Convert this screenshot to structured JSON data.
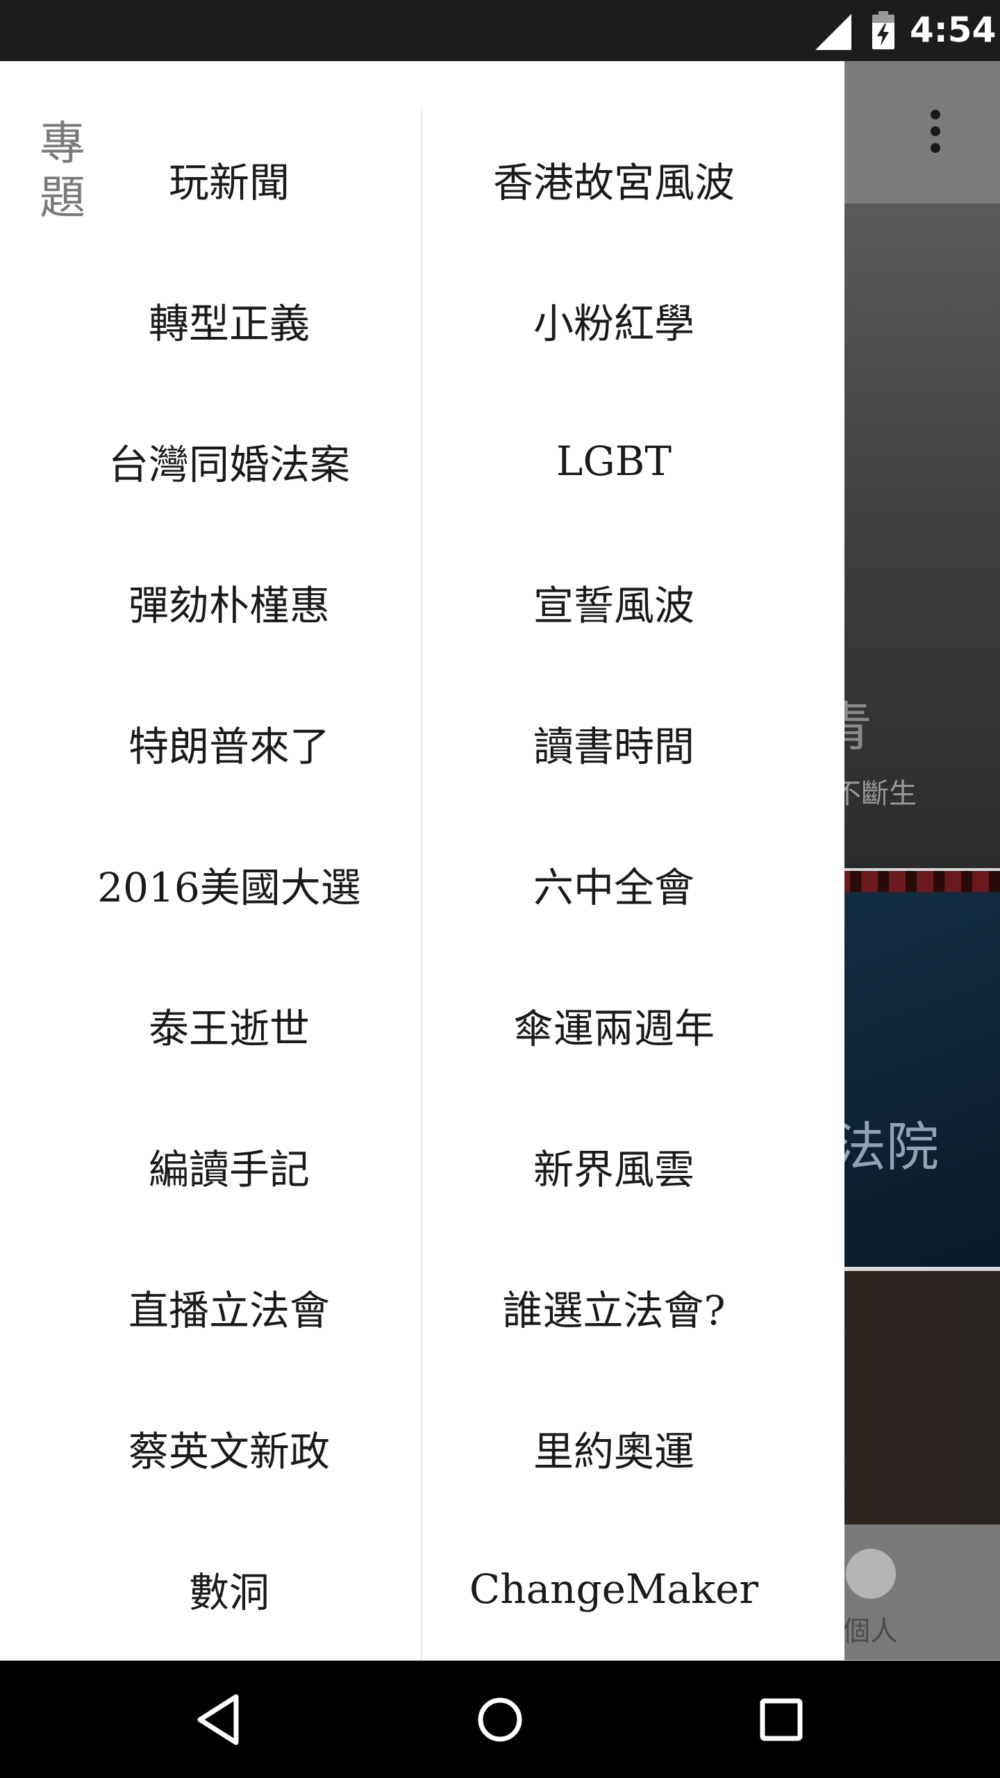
{
  "status_bar": {
    "time": "4:54",
    "icons": [
      "signal-icon",
      "battery-charging-icon"
    ]
  },
  "background": {
    "card1_title": "青",
    "card1_subtitle": "不斷生",
    "card2_title": "法院",
    "bottom_nav_label": "個人"
  },
  "drawer": {
    "section_title": [
      "專",
      "題"
    ],
    "left_column": [
      "玩新聞",
      "轉型正義",
      "台灣同婚法案",
      "彈劾朴槿惠",
      "特朗普來了",
      "2016美國大選",
      "泰王逝世",
      "編讀手記",
      "直播立法會",
      "蔡英文新政",
      "數洞"
    ],
    "right_column": [
      "香港故宮風波",
      "小粉紅學",
      "LGBT",
      "宣誓風波",
      "讀書時間",
      "六中全會",
      "傘運兩週年",
      "新界風雲",
      "誰選立法會?",
      "里約奧運",
      "ChangeMaker"
    ]
  },
  "nav_bar": {
    "icons": [
      "back-icon",
      "home-icon",
      "recents-icon"
    ]
  }
}
